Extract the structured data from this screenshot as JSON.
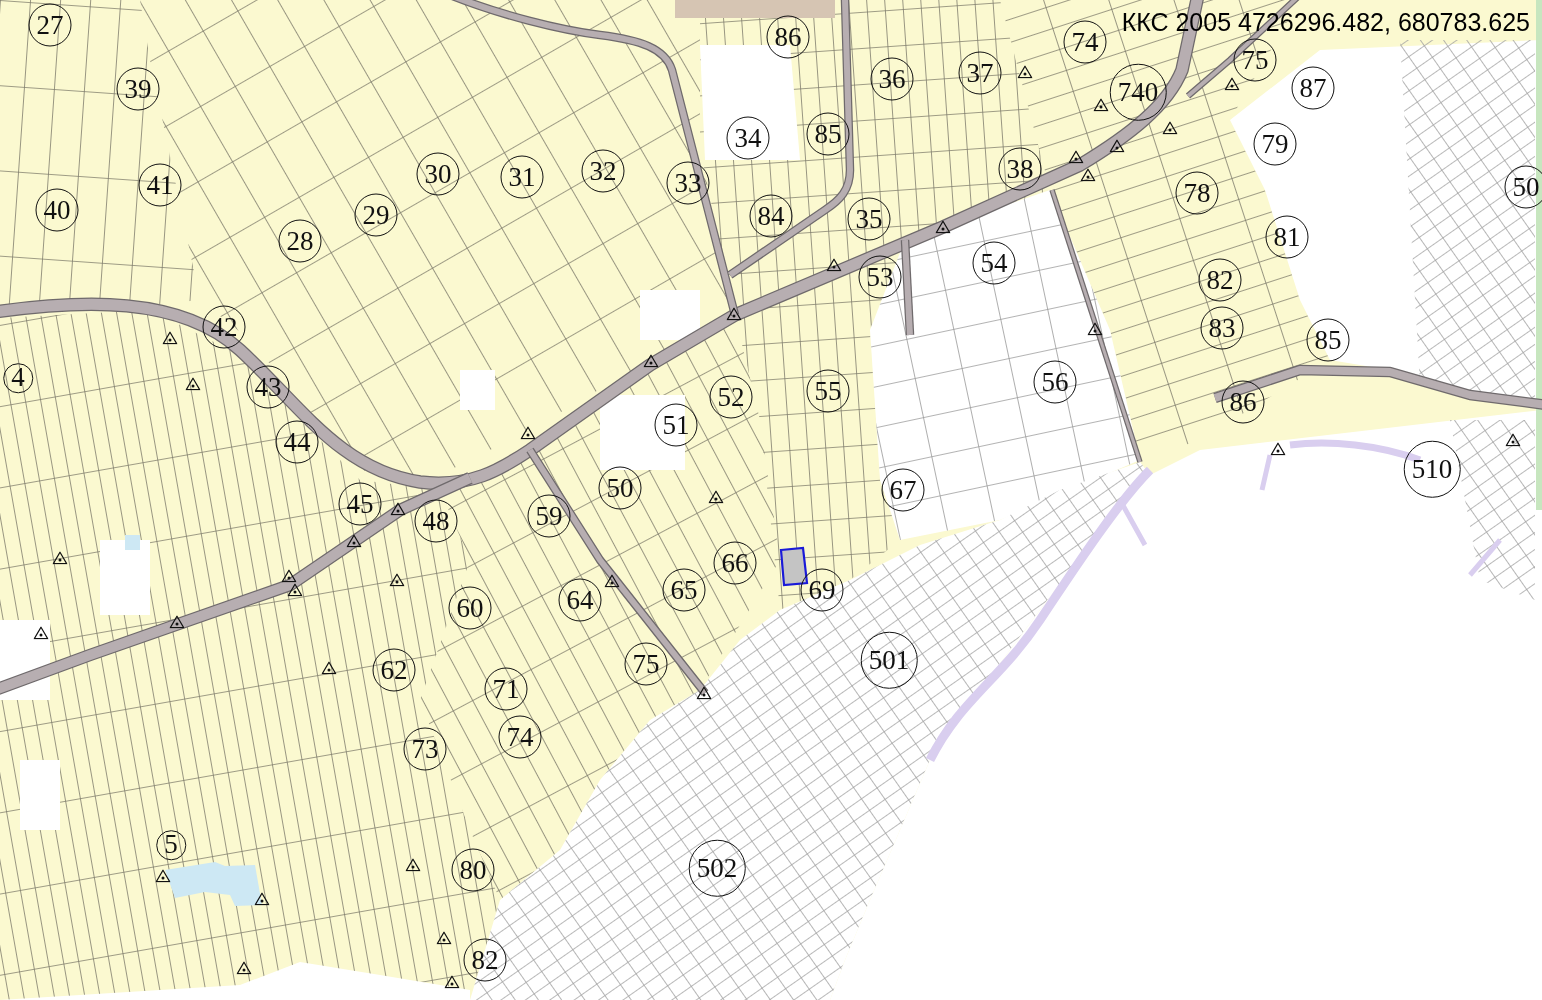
{
  "coordinate_readout": "ККС 2005 4726296.482, 680783.625",
  "map": {
    "area_numbers": [
      "27",
      "86",
      "74",
      "75",
      "36",
      "37",
      "39",
      "740",
      "87",
      "34",
      "85",
      "79",
      "41",
      "30",
      "31",
      "32",
      "33",
      "38",
      "78",
      "50",
      "40",
      "29",
      "84",
      "35",
      "28",
      "81",
      "53",
      "54",
      "82",
      "42",
      "83",
      "85",
      "4",
      "43",
      "52",
      "55",
      "56",
      "86",
      "44",
      "51",
      "50",
      "67",
      "510",
      "45",
      "48",
      "59",
      "66",
      "60",
      "64",
      "65",
      "69",
      "62",
      "71",
      "75",
      "501",
      "73",
      "74",
      "5",
      "80",
      "502",
      "82"
    ]
  }
}
